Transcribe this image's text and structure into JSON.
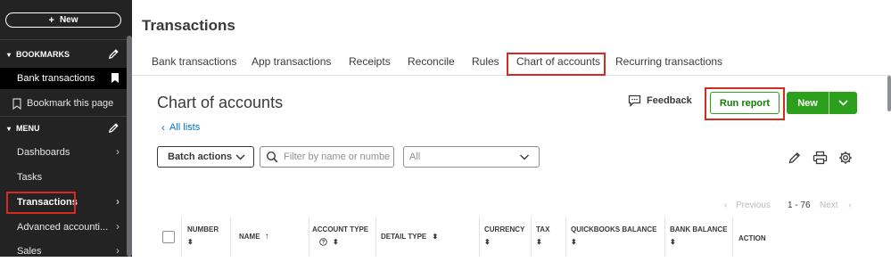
{
  "sidebar": {
    "new_label": "New",
    "bookmarks_label": "BOOKMARKS",
    "bookmark_items": [
      {
        "label": "Bank transactions"
      },
      {
        "label": "Bookmark this page"
      }
    ],
    "menu_label": "MENU",
    "menu_items": [
      {
        "label": "Dashboards"
      },
      {
        "label": "Tasks"
      },
      {
        "label": "Transactions"
      },
      {
        "label": "Advanced accounti..."
      },
      {
        "label": "Sales"
      }
    ]
  },
  "page": {
    "title": "Transactions",
    "tabs": [
      {
        "label": "Bank transactions"
      },
      {
        "label": "App transactions"
      },
      {
        "label": "Receipts"
      },
      {
        "label": "Reconcile"
      },
      {
        "label": "Rules"
      },
      {
        "label": "Chart of accounts"
      },
      {
        "label": "Recurring transactions"
      }
    ]
  },
  "coa": {
    "title": "Chart of accounts",
    "all_lists": "All lists",
    "feedback": "Feedback",
    "run_report": "Run report",
    "new_label": "New",
    "batch_actions": "Batch actions",
    "filter_placeholder": "Filter by name or number",
    "select_value": "All",
    "pager": {
      "previous": "Previous",
      "range": "1 - 76",
      "next": "Next"
    }
  },
  "table": {
    "columns": [
      {
        "label": "NUMBER"
      },
      {
        "label": "NAME"
      },
      {
        "label": "ACCOUNT TYPE"
      },
      {
        "label": "DETAIL TYPE"
      },
      {
        "label": "CURRENCY"
      },
      {
        "label": "TAX"
      },
      {
        "label": "QUICKBOOKS BALANCE"
      },
      {
        "label": "BANK BALANCE"
      },
      {
        "label": "ACTION"
      }
    ]
  },
  "colors": {
    "sidebar_bg": "#232323",
    "accent_green": "#2ca01c",
    "link_blue": "#0077c5",
    "highlight_red": "#d52b1e"
  }
}
